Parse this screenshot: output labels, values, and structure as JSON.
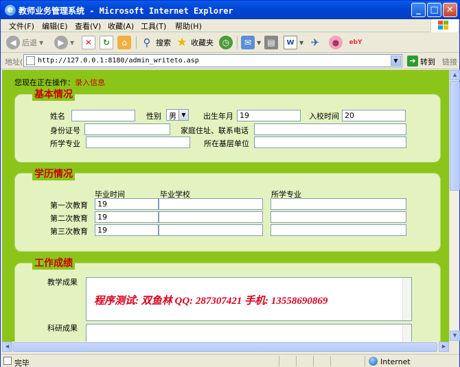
{
  "window": {
    "title": "教师业务管理系统 - Microsoft Internet Explorer",
    "minimize": "_",
    "maximize": "□",
    "close": "✕"
  },
  "menu": [
    "文件(F)",
    "编辑(E)",
    "查看(V)",
    "收藏(A)",
    "工具(T)",
    "帮助(H)"
  ],
  "toolbar": {
    "back": "后退",
    "search": "搜索",
    "favorites": "收藏夹"
  },
  "address": {
    "label": "地址(D)",
    "url": "http://127.0.0.1:8180/admin_writeto.asp",
    "go": "转到",
    "links": "链接"
  },
  "page": {
    "op_prefix": "您现在正在操作：",
    "op_value": "录入信息",
    "basic": {
      "legend": "基本情况",
      "name_label": "姓名",
      "gender_label": "性别",
      "gender_value": "男",
      "birth_label": "出生年月",
      "birth_value": "19",
      "entry_label": "入校时间",
      "entry_value": "20",
      "id_label": "身份证号",
      "address_label": "家庭住址、联系电话",
      "major_label": "所学专业",
      "unit_label": "所在基层单位"
    },
    "education": {
      "legend": "学历情况",
      "col_time": "毕业时间",
      "col_school": "毕业学校",
      "col_major": "所学专业",
      "rows": [
        {
          "label": "第一次教育",
          "time": "19"
        },
        {
          "label": "第二次教育",
          "time": "19"
        },
        {
          "label": "第三次教育",
          "time": "19"
        }
      ]
    },
    "work": {
      "legend": "工作成绩",
      "teaching_label": "教学成果",
      "research_label": "科研成果"
    },
    "watermark": "程序测试: 双鱼林   QQ: 287307421  手机: 13558690869"
  },
  "status": {
    "text": "完毕",
    "zone": "Internet"
  }
}
